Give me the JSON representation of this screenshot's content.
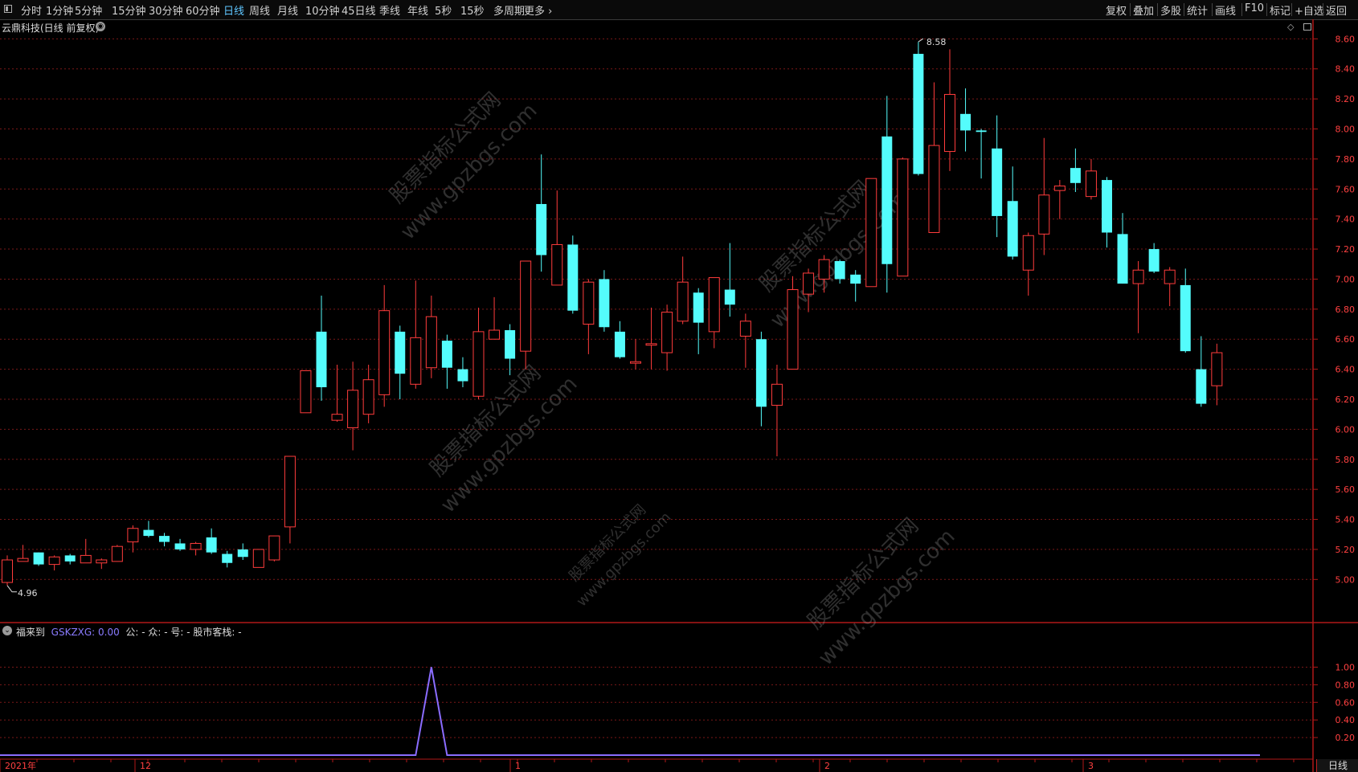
{
  "toolbar": {
    "tabs": [
      "分时",
      "1分钟",
      "5分钟",
      "15分钟",
      "30分钟",
      "60分钟",
      "日线",
      "周线",
      "月线",
      "10分钟",
      "45日线",
      "季线",
      "年线",
      "5秒",
      "15秒",
      "多周期",
      "更多"
    ],
    "active": "日线",
    "right_buttons": [
      "复权",
      "叠加",
      "多股",
      "统计",
      "画线",
      "F10",
      "标记",
      "+自选",
      "返回"
    ]
  },
  "chart_title": "云鼎科技(日线 前复权)",
  "indicator": {
    "name": "福来到",
    "code_label": "GSKZXG: 0.00",
    "rest": "公: -  众: -  号: -  股市客栈: -",
    "y_ticks": [
      "1.00",
      "0.80",
      "0.60",
      "0.40",
      "0.20"
    ]
  },
  "price_axis": [
    "8.60",
    "8.40",
    "8.20",
    "8.00",
    "7.80",
    "7.60",
    "7.40",
    "7.20",
    "7.00",
    "6.80",
    "6.60",
    "6.40",
    "6.20",
    "6.00",
    "5.80",
    "5.60",
    "5.40",
    "5.20",
    "5.00"
  ],
  "annotations": {
    "high": "8.58",
    "low": "4.96"
  },
  "date_axis": [
    "2021年",
    "12",
    "1",
    "2",
    "3"
  ],
  "period_label": "日线",
  "watermark": [
    "股票指标公式网",
    "www.gpzbgs.com"
  ],
  "colors": {
    "up": "#ff3c3c",
    "down": "#54fcfc",
    "line": "#8a6cff",
    "grid": "#7a1818"
  },
  "chart_data": [
    {
      "type": "candlestick",
      "title": "云鼎科技(日线 前复权)",
      "ylim": [
        4.9,
        8.65
      ],
      "candles": [
        {
          "o": 4.98,
          "h": 5.16,
          "l": 4.96,
          "c": 5.13
        },
        {
          "o": 5.12,
          "h": 5.23,
          "l": 5.12,
          "c": 5.14
        },
        {
          "o": 5.18,
          "h": 5.18,
          "l": 5.09,
          "c": 5.1
        },
        {
          "o": 5.1,
          "h": 5.16,
          "l": 5.06,
          "c": 5.15
        },
        {
          "o": 5.16,
          "h": 5.17,
          "l": 5.1,
          "c": 5.12
        },
        {
          "o": 5.11,
          "h": 5.27,
          "l": 5.11,
          "c": 5.16
        },
        {
          "o": 5.11,
          "h": 5.14,
          "l": 5.07,
          "c": 5.13
        },
        {
          "o": 5.12,
          "h": 5.23,
          "l": 5.12,
          "c": 5.22
        },
        {
          "o": 5.25,
          "h": 5.36,
          "l": 5.18,
          "c": 5.34
        },
        {
          "o": 5.33,
          "h": 5.39,
          "l": 5.28,
          "c": 5.29
        },
        {
          "o": 5.29,
          "h": 5.31,
          "l": 5.22,
          "c": 5.25
        },
        {
          "o": 5.24,
          "h": 5.27,
          "l": 5.19,
          "c": 5.2
        },
        {
          "o": 5.2,
          "h": 5.25,
          "l": 5.16,
          "c": 5.24
        },
        {
          "o": 5.28,
          "h": 5.34,
          "l": 5.17,
          "c": 5.18
        },
        {
          "o": 5.17,
          "h": 5.19,
          "l": 5.08,
          "c": 5.11
        },
        {
          "o": 5.2,
          "h": 5.24,
          "l": 5.13,
          "c": 5.15
        },
        {
          "o": 5.08,
          "h": 5.2,
          "l": 5.08,
          "c": 5.2
        },
        {
          "o": 5.13,
          "h": 5.28,
          "l": 5.12,
          "c": 5.29
        },
        {
          "o": 5.35,
          "h": 5.82,
          "l": 5.24,
          "c": 5.82
        },
        {
          "o": 6.11,
          "h": 6.39,
          "l": 6.11,
          "c": 6.39
        },
        {
          "o": 6.65,
          "h": 6.89,
          "l": 6.19,
          "c": 6.28
        },
        {
          "o": 6.06,
          "h": 6.43,
          "l": 6.05,
          "c": 6.1
        },
        {
          "o": 6.01,
          "h": 6.45,
          "l": 5.86,
          "c": 6.26
        },
        {
          "o": 6.1,
          "h": 6.43,
          "l": 6.04,
          "c": 6.33
        },
        {
          "o": 6.23,
          "h": 6.96,
          "l": 6.15,
          "c": 6.79
        },
        {
          "o": 6.65,
          "h": 6.69,
          "l": 6.2,
          "c": 6.37
        },
        {
          "o": 6.3,
          "h": 6.99,
          "l": 6.27,
          "c": 6.61
        },
        {
          "o": 6.41,
          "h": 6.89,
          "l": 6.34,
          "c": 6.75
        },
        {
          "o": 6.59,
          "h": 6.63,
          "l": 6.27,
          "c": 6.41
        },
        {
          "o": 6.4,
          "h": 6.48,
          "l": 6.28,
          "c": 6.32
        },
        {
          "o": 6.22,
          "h": 6.81,
          "l": 6.2,
          "c": 6.65
        },
        {
          "o": 6.6,
          "h": 6.88,
          "l": 6.6,
          "c": 6.66
        },
        {
          "o": 6.66,
          "h": 6.7,
          "l": 6.36,
          "c": 6.47
        },
        {
          "o": 6.52,
          "h": 7.12,
          "l": 6.4,
          "c": 7.12
        },
        {
          "o": 7.5,
          "h": 7.83,
          "l": 7.05,
          "c": 7.16
        },
        {
          "o": 6.96,
          "h": 7.59,
          "l": 6.96,
          "c": 7.23
        },
        {
          "o": 7.23,
          "h": 7.29,
          "l": 6.77,
          "c": 6.79
        },
        {
          "o": 6.7,
          "h": 7.0,
          "l": 6.5,
          "c": 6.98
        },
        {
          "o": 7.0,
          "h": 7.06,
          "l": 6.65,
          "c": 6.68
        },
        {
          "o": 6.65,
          "h": 6.72,
          "l": 6.47,
          "c": 6.48
        },
        {
          "o": 6.44,
          "h": 6.6,
          "l": 6.4,
          "c": 6.45
        },
        {
          "o": 6.56,
          "h": 6.81,
          "l": 6.4,
          "c": 6.57
        },
        {
          "o": 6.51,
          "h": 6.83,
          "l": 6.39,
          "c": 6.78
        },
        {
          "o": 6.72,
          "h": 7.15,
          "l": 6.7,
          "c": 6.98
        },
        {
          "o": 6.91,
          "h": 6.94,
          "l": 6.5,
          "c": 6.71
        },
        {
          "o": 6.65,
          "h": 7.0,
          "l": 6.54,
          "c": 7.01
        },
        {
          "o": 6.93,
          "h": 7.24,
          "l": 6.75,
          "c": 6.83
        },
        {
          "o": 6.62,
          "h": 6.77,
          "l": 6.41,
          "c": 6.72
        },
        {
          "o": 6.6,
          "h": 6.65,
          "l": 6.02,
          "c": 6.15
        },
        {
          "o": 6.16,
          "h": 6.43,
          "l": 5.82,
          "c": 6.3
        },
        {
          "o": 6.4,
          "h": 7.02,
          "l": 6.4,
          "c": 6.93
        },
        {
          "o": 6.9,
          "h": 7.07,
          "l": 6.78,
          "c": 7.04
        },
        {
          "o": 7.0,
          "h": 7.16,
          "l": 6.91,
          "c": 7.13
        },
        {
          "o": 7.12,
          "h": 7.13,
          "l": 6.97,
          "c": 7.0
        },
        {
          "o": 7.03,
          "h": 7.06,
          "l": 6.85,
          "c": 6.97
        },
        {
          "o": 6.95,
          "h": 7.67,
          "l": 6.95,
          "c": 7.67
        },
        {
          "o": 7.95,
          "h": 8.22,
          "l": 6.91,
          "c": 7.1
        },
        {
          "o": 7.02,
          "h": 7.81,
          "l": 7.02,
          "c": 7.8
        },
        {
          "o": 8.5,
          "h": 8.58,
          "l": 7.69,
          "c": 7.7
        },
        {
          "o": 7.31,
          "h": 8.31,
          "l": 7.31,
          "c": 7.89
        },
        {
          "o": 7.85,
          "h": 8.53,
          "l": 7.72,
          "c": 8.23
        },
        {
          "o": 8.1,
          "h": 8.27,
          "l": 7.85,
          "c": 7.99
        },
        {
          "o": 7.99,
          "h": 8.0,
          "l": 7.67,
          "c": 7.98
        },
        {
          "o": 7.87,
          "h": 8.09,
          "l": 7.28,
          "c": 7.42
        },
        {
          "o": 7.52,
          "h": 7.75,
          "l": 7.13,
          "c": 7.15
        },
        {
          "o": 7.06,
          "h": 7.31,
          "l": 6.89,
          "c": 7.29
        },
        {
          "o": 7.3,
          "h": 7.94,
          "l": 7.16,
          "c": 7.56
        },
        {
          "o": 7.59,
          "h": 7.66,
          "l": 7.4,
          "c": 7.62
        },
        {
          "o": 7.74,
          "h": 7.87,
          "l": 7.58,
          "c": 7.64
        },
        {
          "o": 7.55,
          "h": 7.8,
          "l": 7.53,
          "c": 7.72
        },
        {
          "o": 7.66,
          "h": 7.68,
          "l": 7.21,
          "c": 7.31
        },
        {
          "o": 7.3,
          "h": 7.44,
          "l": 6.97,
          "c": 6.97
        },
        {
          "o": 6.97,
          "h": 7.12,
          "l": 6.64,
          "c": 7.06
        },
        {
          "o": 7.2,
          "h": 7.24,
          "l": 7.04,
          "c": 7.05
        },
        {
          "o": 6.97,
          "h": 7.08,
          "l": 6.82,
          "c": 7.06
        },
        {
          "o": 6.96,
          "h": 7.07,
          "l": 6.51,
          "c": 6.52
        },
        {
          "o": 6.4,
          "h": 6.62,
          "l": 6.15,
          "c": 6.17
        },
        {
          "o": 6.29,
          "h": 6.57,
          "l": 6.16,
          "c": 6.51
        }
      ]
    },
    {
      "type": "line",
      "name": "GSKZXG",
      "ylim": [
        0,
        1.05
      ],
      "values": [
        0,
        0,
        0,
        0,
        0,
        0,
        0,
        0,
        0,
        0,
        0,
        0,
        0,
        0,
        0,
        0,
        0,
        0,
        0,
        0,
        0,
        0,
        0,
        0,
        0,
        0,
        0,
        1,
        0,
        0,
        0,
        0,
        0,
        0,
        0,
        0,
        0,
        0,
        0,
        0,
        0,
        0,
        0,
        0,
        0,
        0,
        0,
        0,
        0,
        0,
        0,
        0,
        0,
        0,
        0,
        0,
        0,
        0,
        0,
        0,
        0,
        0,
        0,
        0,
        0,
        0,
        0,
        0,
        0,
        0,
        0,
        0,
        0,
        0,
        0,
        0,
        0,
        0
      ]
    }
  ]
}
